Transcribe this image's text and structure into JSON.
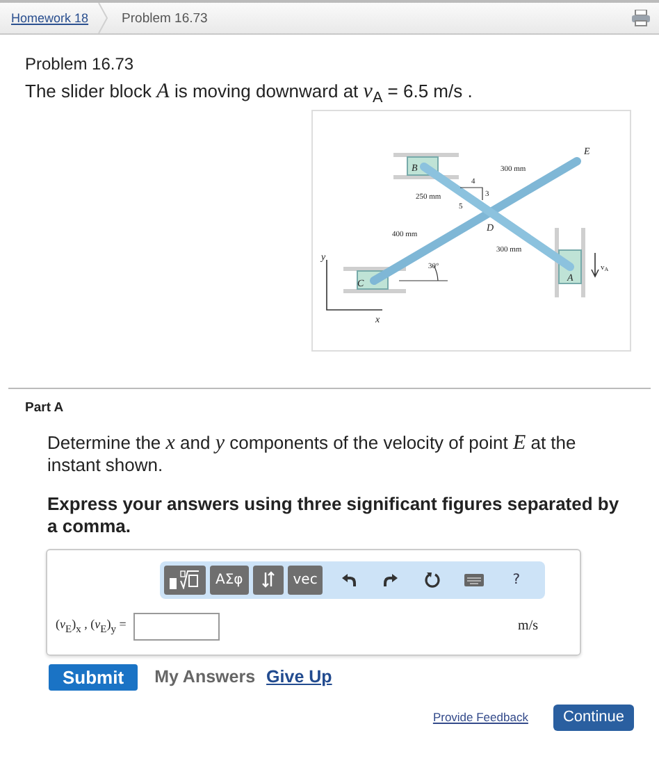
{
  "breadcrumbs": [
    {
      "label": "Homework 18",
      "kind": "link"
    },
    {
      "label": "Problem 16.73",
      "kind": "current"
    }
  ],
  "problem": {
    "title": "Problem 16.73",
    "statement": "The slider block *A* is moving downward at *v*$_{A}$ = 6.5  m/s ."
  },
  "figure": {
    "labels": [
      "B",
      "E",
      "300 mm",
      "4",
      "3",
      "5",
      "250 mm",
      "400 mm",
      "D",
      "300 mm",
      "30°",
      "C",
      "A",
      "y",
      "x",
      "v$_{A}$"
    ]
  },
  "part": {
    "title": "Part A",
    "question": "Determine the *x* and *y* components of the velocity of point *E* at the instant shown.",
    "instruction": "Express your answers using three significant figures separated by a comma."
  },
  "toolbar": [
    {
      "kind": "templates"
    },
    {
      "kind": "text",
      "label": "ΑΣφ"
    },
    {
      "kind": "sort"
    },
    {
      "kind": "text",
      "label": "vec"
    },
    {
      "kind": "undo"
    },
    {
      "kind": "redo"
    },
    {
      "kind": "reset"
    },
    {
      "kind": "keyboard"
    },
    {
      "kind": "plain",
      "label": "?"
    }
  ],
  "answer": {
    "label": "(*v*$_{E}$)$_{x}$ , (*v*$_{E}$)$_{y}$ =",
    "units": "m/s"
  },
  "actions": {
    "submit": "Submit",
    "my_answers": "My Answers",
    "give_up": "Give Up"
  },
  "footer": {
    "feedback": "Provide Feedback",
    "continue": "Continue"
  }
}
